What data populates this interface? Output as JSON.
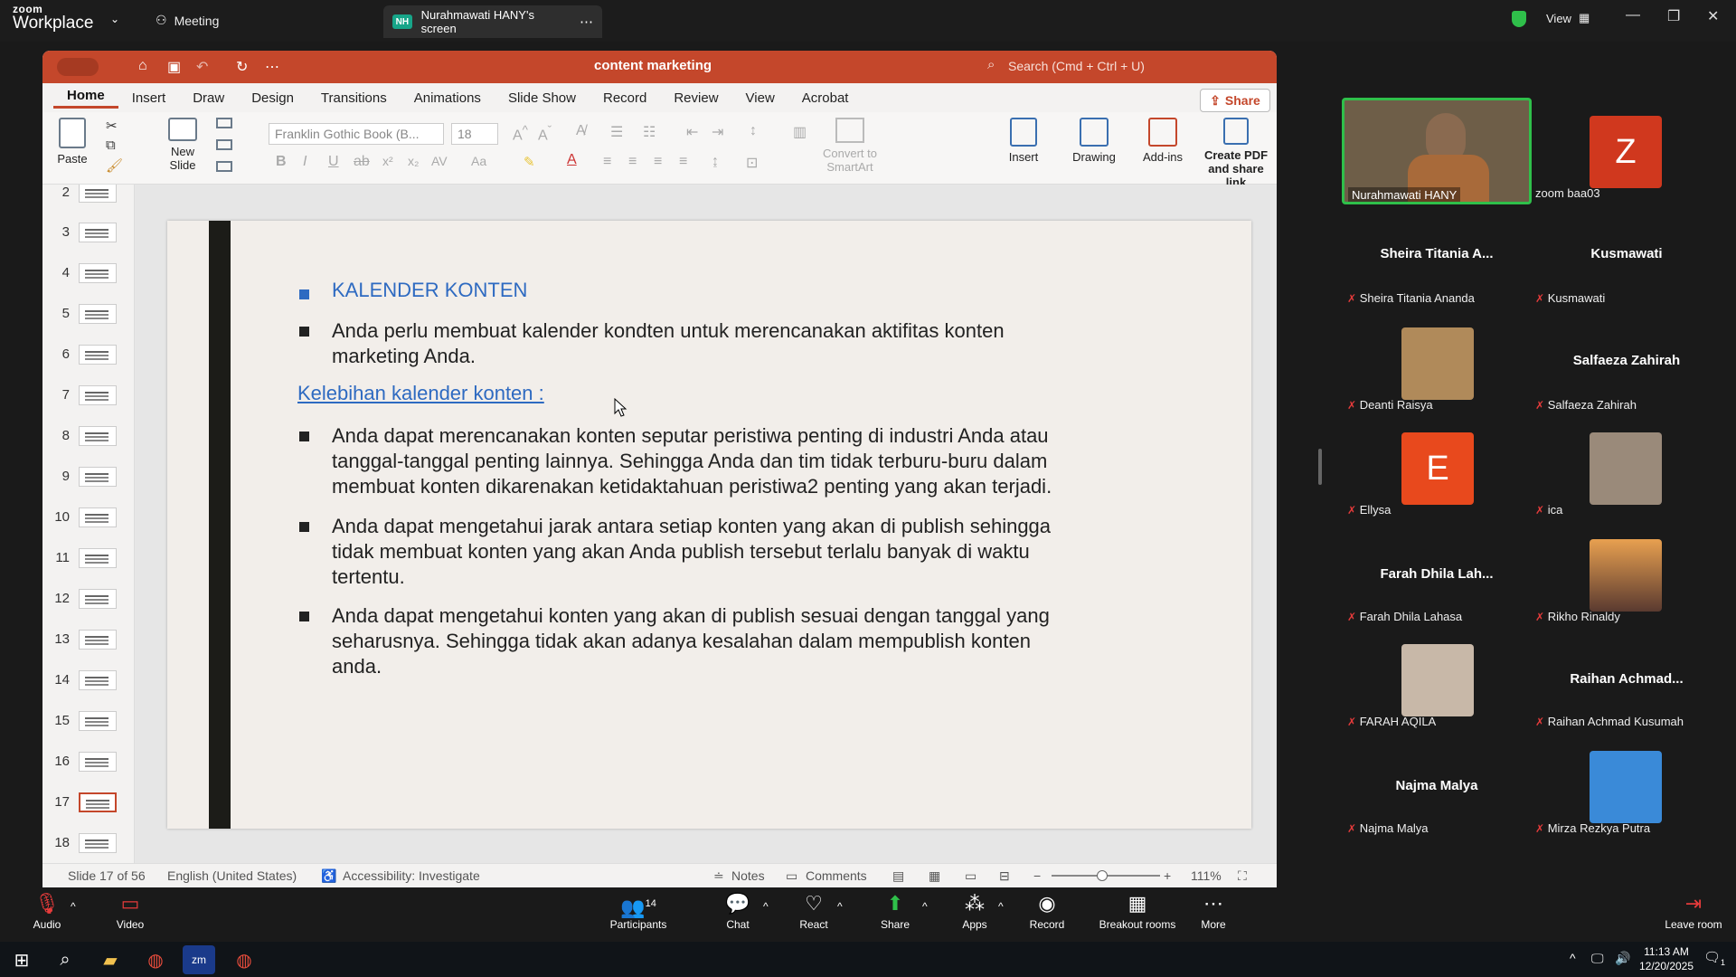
{
  "zoom": {
    "logo_line1": "zoom",
    "logo_line2": "Workplace",
    "meeting_label": "Meeting",
    "screen_tab": "Nurahmawati HANY's screen",
    "screen_badge": "NH",
    "view_label": "View"
  },
  "ppt": {
    "doc_title": "content marketing",
    "search_placeholder": "Search (Cmd + Ctrl + U)",
    "share_label": "Share",
    "menu": [
      "Home",
      "Insert",
      "Draw",
      "Design",
      "Transitions",
      "Animations",
      "Slide Show",
      "Record",
      "Review",
      "View",
      "Acrobat"
    ],
    "ribbon": {
      "paste": "Paste",
      "new_slide_1": "New",
      "new_slide_2": "Slide",
      "font_name": "Franklin Gothic Book (B...",
      "font_size": "18",
      "convert_1": "Convert to",
      "convert_2": "SmartArt",
      "insert": "Insert",
      "drawing": "Drawing",
      "addins": "Add-ins",
      "pdf_1": "Create PDF",
      "pdf_2": "and share link"
    },
    "thumbnails": [
      "2",
      "3",
      "4",
      "5",
      "6",
      "7",
      "8",
      "9",
      "10",
      "11",
      "12",
      "13",
      "14",
      "15",
      "16",
      "17",
      "18"
    ],
    "slide": {
      "heading": "KALENDER KONTEN",
      "bullet1_l1": "Anda perlu membuat kalender kondten untuk merencanakan aktifitas konten",
      "bullet1_l2": "marketing Anda.",
      "subheading": "Kelebihan kalender konten :",
      "b2_l1": "Anda dapat merencanakan konten seputar peristiwa penting di industri Anda atau",
      "b2_l2": "tanggal-tanggal penting lainnya. Sehingga Anda dan tim tidak terburu-buru dalam",
      "b2_l3": "membuat konten dikarenakan ketidaktahuan peristiwa2 penting yang akan terjadi.",
      "b3_l1": "Anda dapat mengetahui jarak antara setiap konten yang akan di publish sehingga",
      "b3_l2": "tidak membuat konten yang akan Anda publish tersebut terlalu banyak di waktu",
      "b3_l3": "tertentu.",
      "b4_l1": "Anda dapat mengetahui konten yang akan di publish sesuai dengan tanggal yang",
      "b4_l2": "seharusnya. Sehingga tidak akan adanya kesalahan dalam mempublish konten",
      "b4_l3": "anda."
    },
    "status": {
      "slide_no": "Slide 17 of 56",
      "language": "English (United States)",
      "accessibility": "Accessibility: Investigate",
      "notes": "Notes",
      "comments": "Comments",
      "zoom_pct": "111%"
    }
  },
  "participants": [
    {
      "name": "Nurahmawati HANY",
      "type": "video"
    },
    {
      "name": "zoom baa03",
      "type": "letter",
      "letter": "Z",
      "color": "#d0381e"
    },
    {
      "name": "Sheira Titania Ananda",
      "big": "Sheira Titania A...",
      "type": "name"
    },
    {
      "name": "Kusmawati",
      "big": "Kusmawati",
      "type": "name"
    },
    {
      "name": "Deanti Raisya",
      "type": "photo"
    },
    {
      "name": "Salfaeza Zahirah",
      "big": "Salfaeza Zahirah",
      "type": "name"
    },
    {
      "name": "Ellysa",
      "type": "letter",
      "letter": "E",
      "color": "#e8491d"
    },
    {
      "name": "ica",
      "type": "photo"
    },
    {
      "name": "Farah Dhila Lahasa",
      "big": "Farah Dhila Lah...",
      "type": "name"
    },
    {
      "name": "Rikho Rinaldy",
      "type": "photo"
    },
    {
      "name": "FARAH AQILA",
      "type": "photo"
    },
    {
      "name": "Raihan Achmad Kusumah",
      "big": "Raihan  Achmad...",
      "type": "name"
    },
    {
      "name": "Najma Malya",
      "big": "Najma Malya",
      "type": "name"
    },
    {
      "name": "Mirza Rezkya Putra",
      "type": "photo"
    }
  ],
  "toolbar": {
    "audio": "Audio",
    "video": "Video",
    "participants": "Participants",
    "participants_count": "14",
    "chat": "Chat",
    "react": "React",
    "share": "Share",
    "apps": "Apps",
    "record": "Record",
    "breakout": "Breakout rooms",
    "more": "More",
    "leave": "Leave room"
  },
  "taskbar": {
    "time": "11:13 AM",
    "date": "12/20/2025",
    "notif_count": "1"
  }
}
